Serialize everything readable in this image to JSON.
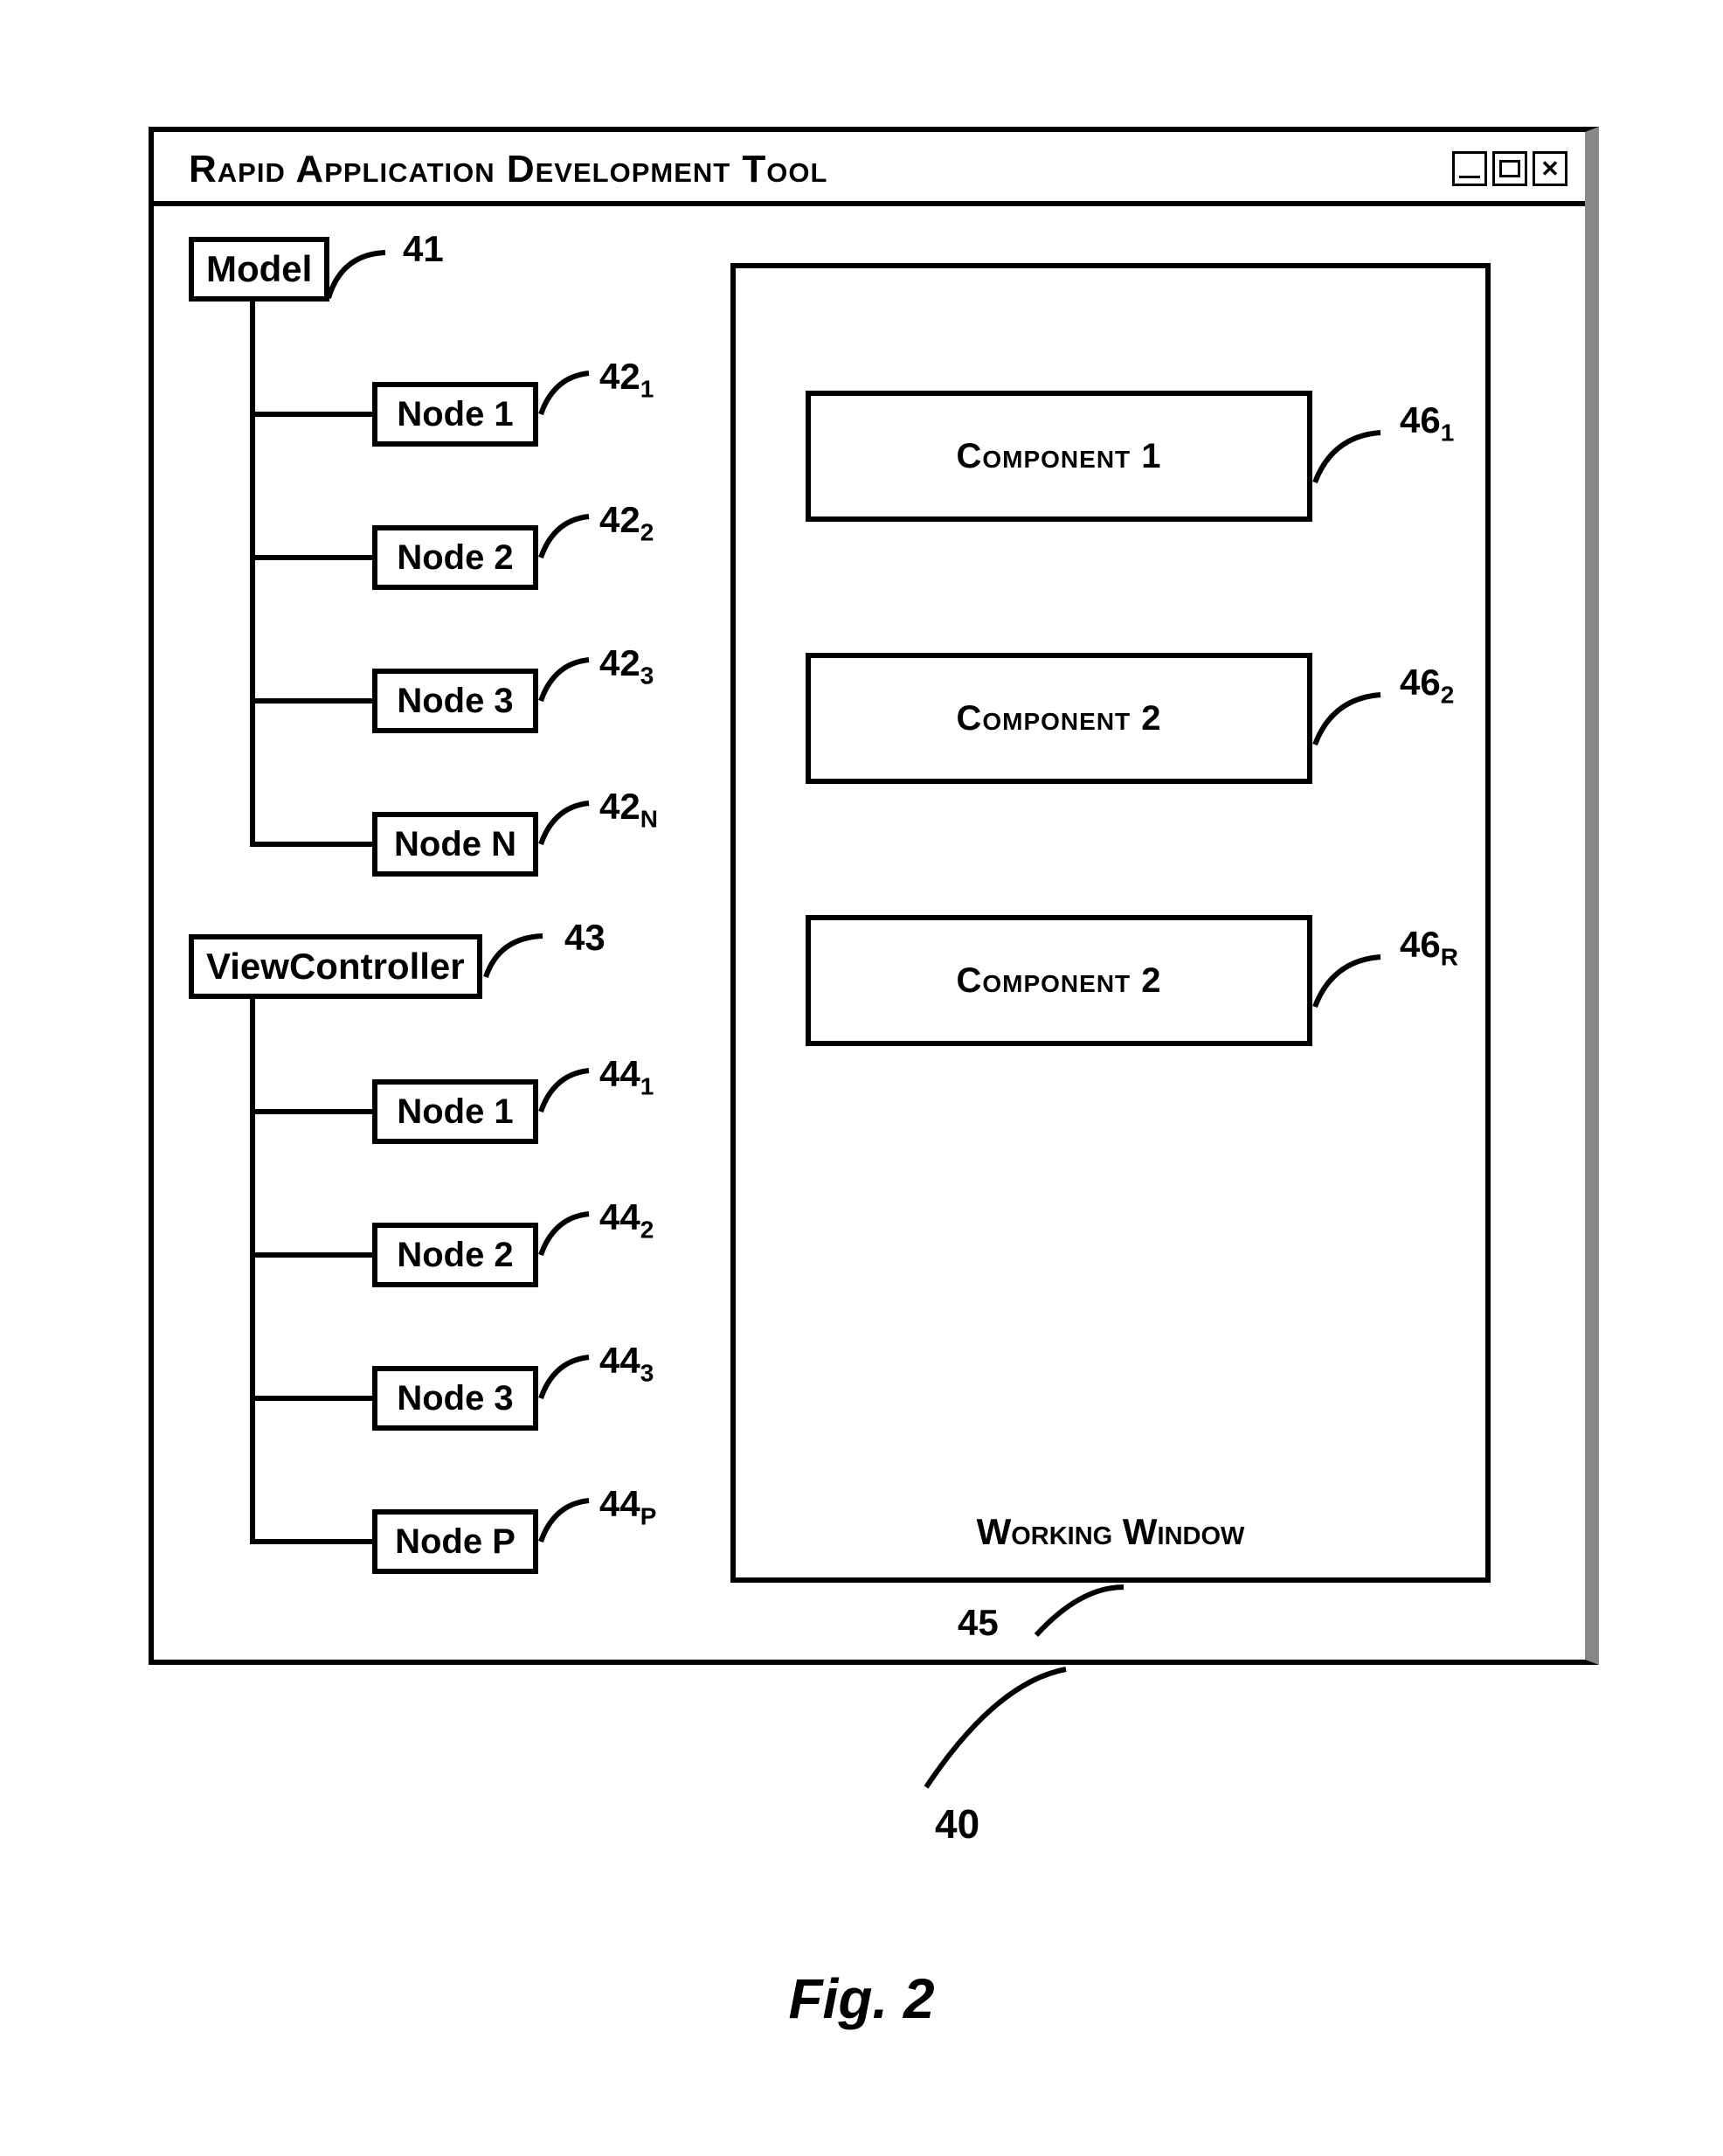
{
  "window": {
    "title": "Rapid Application Development Tool"
  },
  "tree1": {
    "root_label": "Model",
    "root_ref": "41",
    "nodes": [
      {
        "label": "Node 1",
        "ref_base": "42",
        "ref_sub": "1"
      },
      {
        "label": "Node 2",
        "ref_base": "42",
        "ref_sub": "2"
      },
      {
        "label": "Node 3",
        "ref_base": "42",
        "ref_sub": "3"
      },
      {
        "label": "Node N",
        "ref_base": "42",
        "ref_sub": "N"
      }
    ]
  },
  "tree2": {
    "root_label": "ViewController",
    "root_ref": "43",
    "nodes": [
      {
        "label": "Node 1",
        "ref_base": "44",
        "ref_sub": "1"
      },
      {
        "label": "Node 2",
        "ref_base": "44",
        "ref_sub": "2"
      },
      {
        "label": "Node 3",
        "ref_base": "44",
        "ref_sub": "3"
      },
      {
        "label": "Node P",
        "ref_base": "44",
        "ref_sub": "P"
      }
    ]
  },
  "working_window": {
    "label": "Working Window",
    "ref": "45",
    "components": [
      {
        "label": "Component 1",
        "ref_base": "46",
        "ref_sub": "1"
      },
      {
        "label": "Component 2",
        "ref_base": "46",
        "ref_sub": "2"
      },
      {
        "label": "Component 2",
        "ref_base": "46",
        "ref_sub": "R"
      }
    ]
  },
  "window_ref": "40",
  "figure_caption": "Fig. 2"
}
